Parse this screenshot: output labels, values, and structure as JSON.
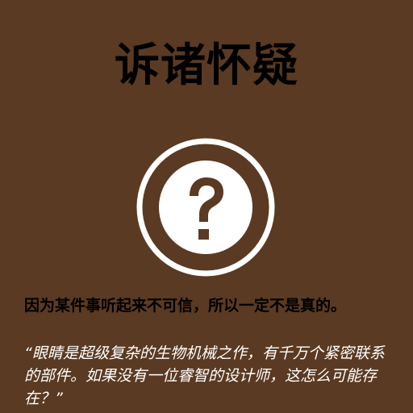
{
  "card": {
    "title": "诉诸怀疑",
    "icon": "question-circle-icon",
    "definition": "因为某件事听起来不可信，所以一定不是真的。",
    "example": "“眼睛是超级复杂的生物机械之作，有千万个紧密联系的部件。如果没有一位睿智的设计师，这怎么可能存在？”"
  },
  "colors": {
    "background": "#5a3a22",
    "title": "#000000",
    "definition": "#000000",
    "example": "#ffffff",
    "icon": "#ffffff"
  }
}
